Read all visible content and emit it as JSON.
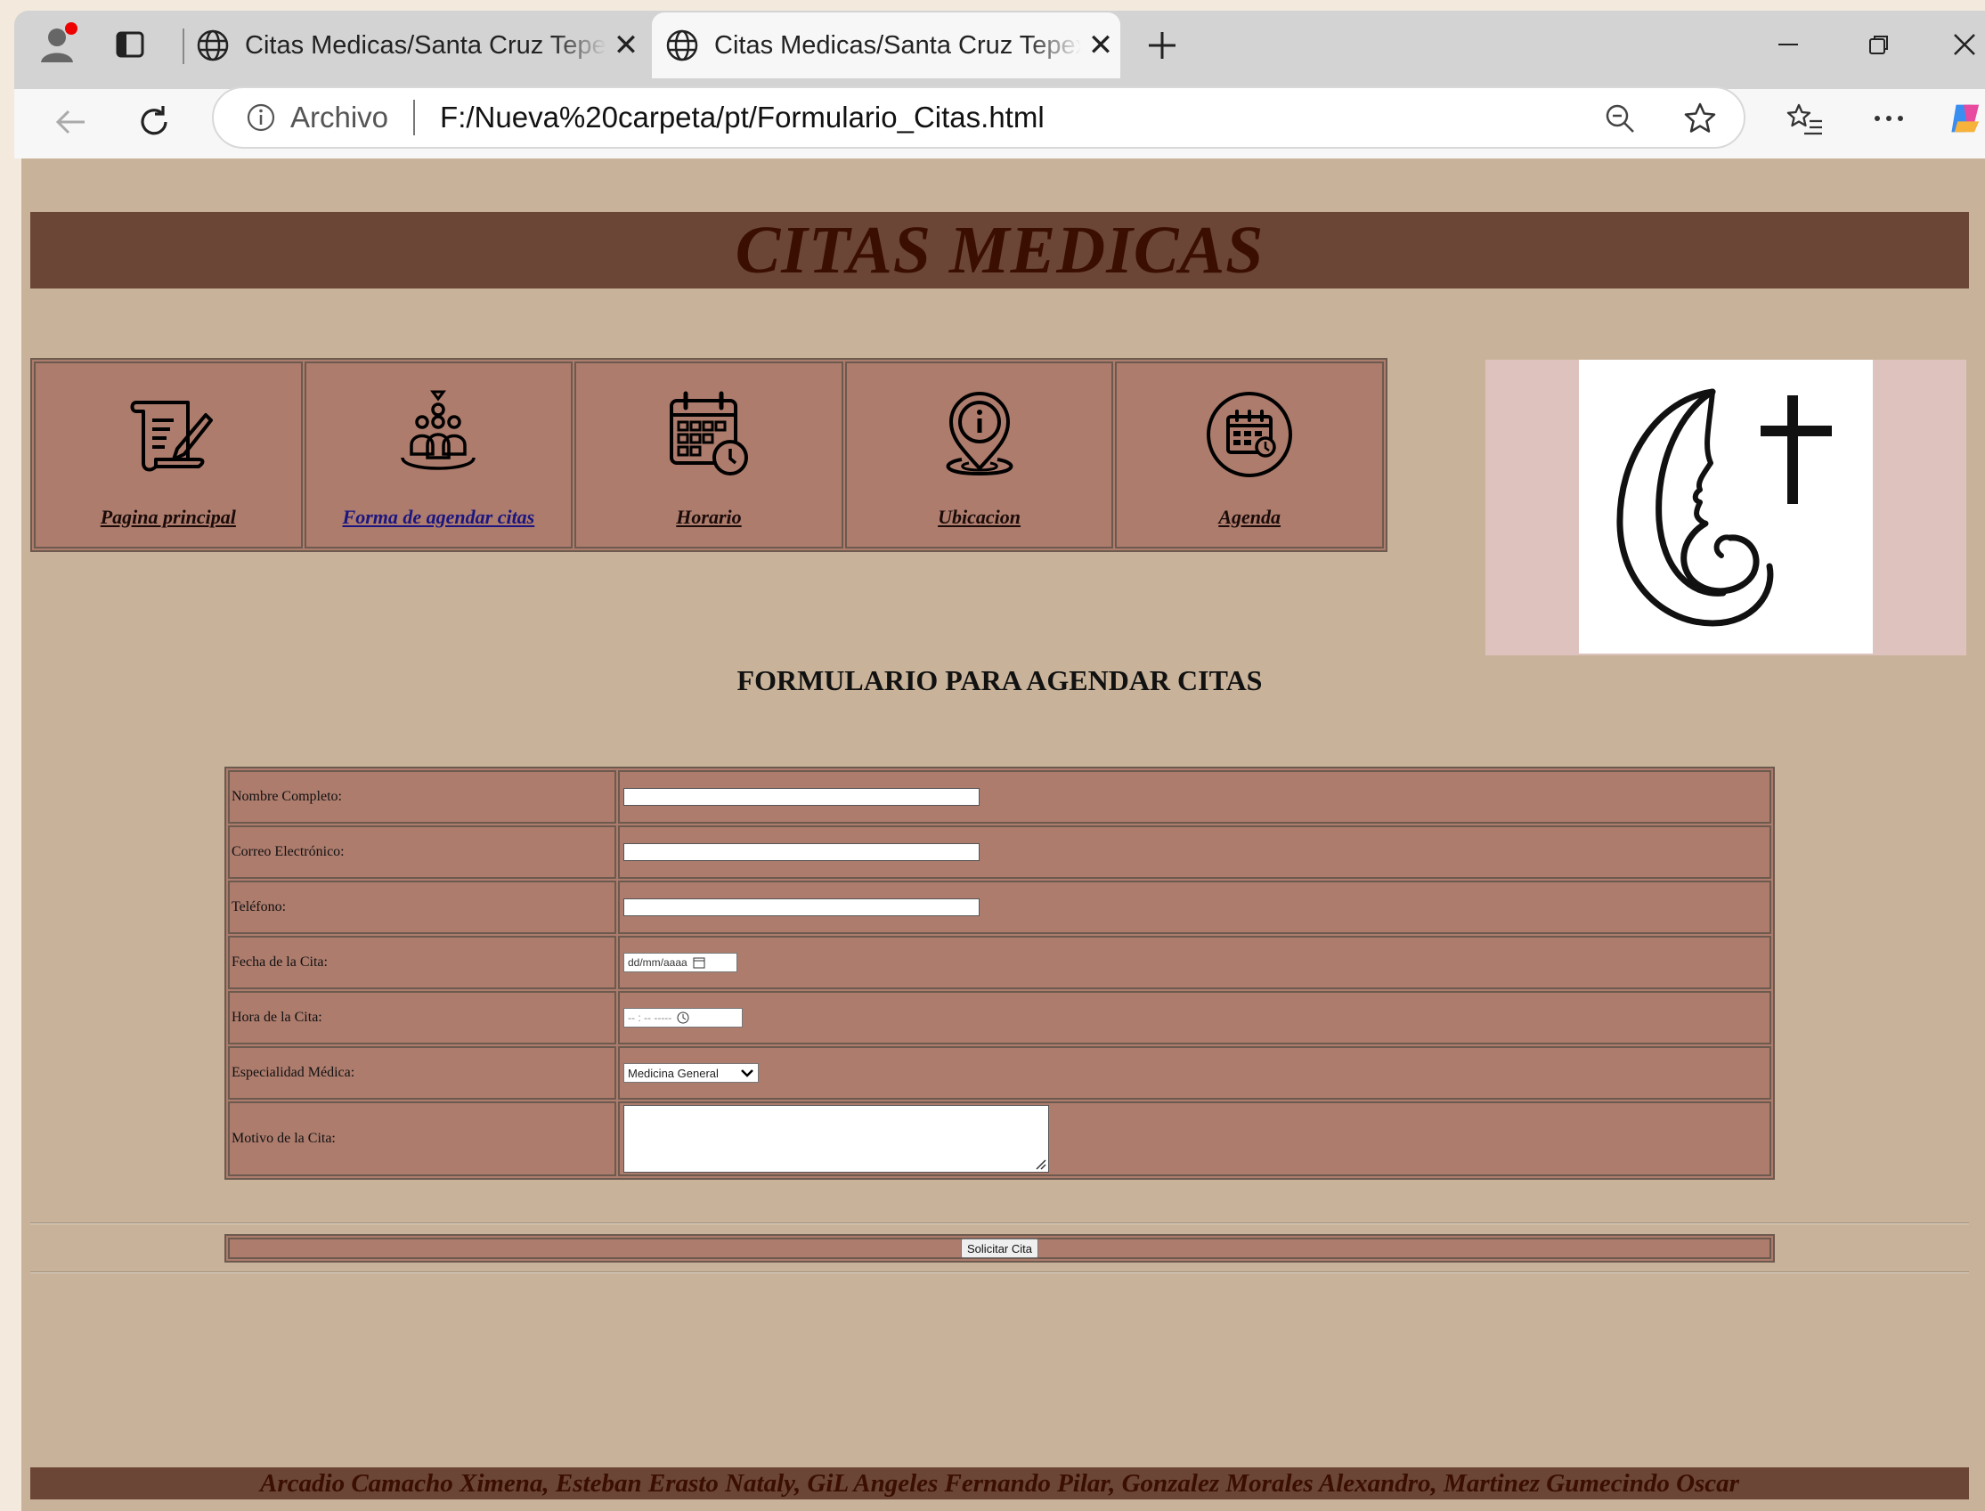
{
  "browser": {
    "tabs": [
      {
        "title": "Citas Medicas/Santa Cruz Tepexpan"
      },
      {
        "title": "Citas Medicas/Santa Cruz Tepexpan"
      }
    ],
    "address": {
      "scheme_label": "Archivo",
      "url": "F:/Nueva%20carpeta/pt/Formulario_Citas.html"
    }
  },
  "page": {
    "banner_title": "CITAS MEDICAS",
    "nav": [
      {
        "label": "Pagina principal",
        "icon": "scroll-icon"
      },
      {
        "label": "Forma de agendar citas",
        "icon": "group-icon"
      },
      {
        "label": "Horario",
        "icon": "calendar-clock-icon"
      },
      {
        "label": "Ubicacion",
        "icon": "location-pin-icon"
      },
      {
        "label": "Agenda",
        "icon": "agenda-icon"
      }
    ],
    "logo_icon": "mother-child-cross-logo",
    "form_title": "FORMULARIO PARA AGENDAR CITAS",
    "form": {
      "name_label": "Nombre Completo:",
      "email_label": "Correo Electrónico:",
      "phone_label": "Teléfono:",
      "date_label": "Fecha de la Cita:",
      "date_placeholder": "dd/mm/aaaa",
      "time_label": "Hora de la Cita:",
      "time_placeholder": "-- : --  -----",
      "specialty_label": "Especialidad Médica:",
      "specialty_selected": "Medicina General",
      "reason_label": "Motivo de la Cita:",
      "submit_label": "Solicitar Cita"
    },
    "footer": "Arcadio Camacho Ximena, Esteban Erasto Nataly, GiL Angeles Fernando Pilar, Gonzalez Morales Alexandro, Martinez Gumecindo Oscar"
  },
  "colors": {
    "page_bg": "#c8b39a",
    "banner": "#6b4536",
    "cell": "#ad7c6d",
    "title_text": "#3a0e00"
  }
}
